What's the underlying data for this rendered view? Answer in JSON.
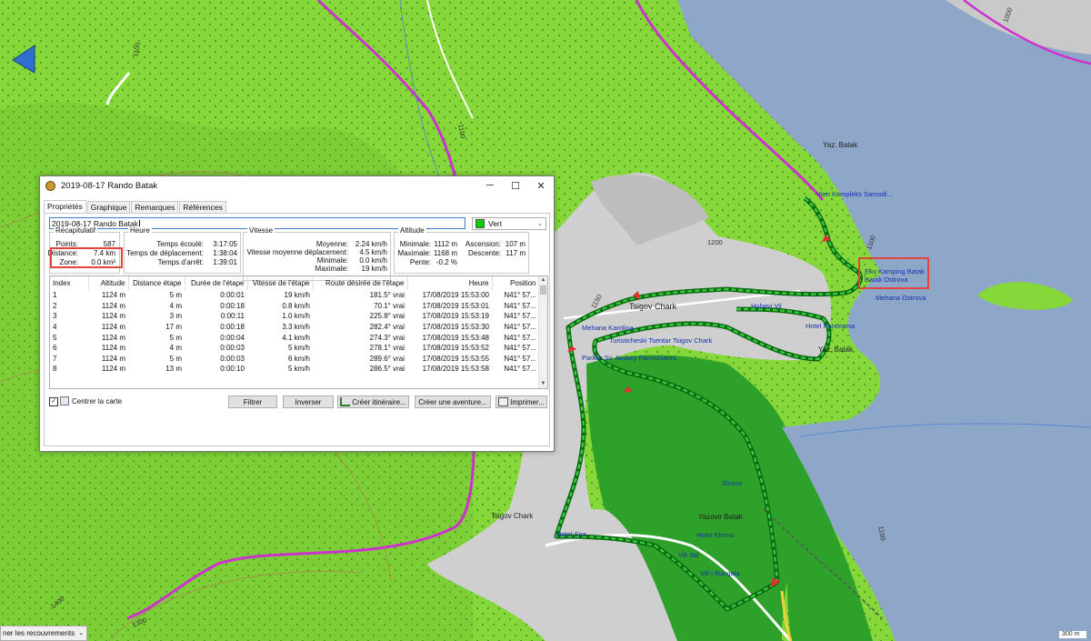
{
  "window": {
    "title": "2019-08-17 Rando Batak",
    "tabs": [
      "Propriétés",
      "Graphique",
      "Remarques",
      "Références"
    ],
    "name_value": "2019-08-17 Rando Batak",
    "color": {
      "label": "Vert",
      "swatch": "#00d000"
    }
  },
  "recap": {
    "title": "Récapitulatif",
    "points_label": "Points:",
    "points_value": "587",
    "distance_label": "Distance:",
    "distance_value": "7.4 km",
    "zone_label": "Zone:",
    "zone_value": "0.0 km²"
  },
  "heure": {
    "title": "Heure",
    "rows": [
      {
        "label": "Temps écoulé:",
        "value": "3:17:05"
      },
      {
        "label": "Temps de déplacement:",
        "value": "1:38:04"
      },
      {
        "label": "Temps d'arrêt:",
        "value": "1:39:01"
      }
    ]
  },
  "vitesse": {
    "title": "Vitesse",
    "rows": [
      {
        "label": "Moyenne:",
        "value": "2.24 km/h"
      },
      {
        "label": "Vitesse moyenne déplacement:",
        "value": "4.5 km/h"
      },
      {
        "label": "Minimale:",
        "value": "0.0 km/h"
      },
      {
        "label": "Maximale:",
        "value": "19 km/h"
      }
    ]
  },
  "altitude": {
    "title": "Altitude",
    "rows": [
      {
        "label": "Minimale:",
        "value": "1112 m"
      },
      {
        "label": "Maximale:",
        "value": "1168 m"
      },
      {
        "label": "Pente:",
        "value": "-0.2 %"
      }
    ],
    "rows2": [
      {
        "label": "Ascension:",
        "value": "107 m"
      },
      {
        "label": "Descente:",
        "value": "117 m"
      }
    ]
  },
  "table": {
    "columns": [
      "Index",
      "Altitude",
      "Distance étape",
      "Durée de l'étape",
      "Vitesse de l'étape",
      "Route désirée de l'étape",
      "Heure",
      "Position"
    ],
    "rows": [
      [
        "1",
        "1124 m",
        "5 m",
        "0:00:01",
        "19 km/h",
        "181.5° vrai",
        "17/08/2019 15:53:00",
        "N41° 57..."
      ],
      [
        "2",
        "1124 m",
        "4 m",
        "0:00:18",
        "0.8 km/h",
        "70.1° vrai",
        "17/08/2019 15:53:01",
        "N41° 57..."
      ],
      [
        "3",
        "1124 m",
        "3 m",
        "0:00:11",
        "1.0 km/h",
        "225.8° vrai",
        "17/08/2019 15:53:19",
        "N41° 57..."
      ],
      [
        "4",
        "1124 m",
        "17 m",
        "0:00:18",
        "3.3 km/h",
        "282.4° vrai",
        "17/08/2019 15:53:30",
        "N41° 57..."
      ],
      [
        "5",
        "1124 m",
        "5 m",
        "0:00:04",
        "4.1 km/h",
        "274.3° vrai",
        "17/08/2019 15:53:48",
        "N41° 57..."
      ],
      [
        "6",
        "1124 m",
        "4 m",
        "0:00:03",
        "5 km/h",
        "278.1° vrai",
        "17/08/2019 15:53:52",
        "N41° 57..."
      ],
      [
        "7",
        "1124 m",
        "5 m",
        "0:00:03",
        "6 km/h",
        "289.6° vrai",
        "17/08/2019 15:53:55",
        "N41° 57..."
      ],
      [
        "8",
        "1124 m",
        "13 m",
        "0:00:10",
        "5 km/h",
        "286.5° vrai",
        "17/08/2019 15:53:58",
        "N41° 57..."
      ]
    ]
  },
  "bottom": {
    "center_map": "Centrer la carte",
    "filter": "Filtrer",
    "invert": "Inverser",
    "create_route": "Créer itinéraire...",
    "create_adventure": "Créer une aventure...",
    "print": "Imprimer..."
  },
  "map": {
    "labels": {
      "tsigov1": "Tsigov Chark",
      "tsigov2": "Tsigov Chark",
      "yaz1": "Yaz. Batak",
      "yaz2": "Yaz. Batak",
      "yazovir": "Yazovir Batak"
    },
    "pois": {
      "samodiva": "Vien Kompleks Samodi...",
      "eko": "Eko Kamping Batak",
      "ostrova": "Batak Ostrova",
      "mehana_ostrova": "Mehana Ostrova",
      "hubavi": "Hubavi Vil",
      "panorama": "Hotel Panorama",
      "karolina": "Mehana Karolina",
      "turist": "Turisticheski Tsentar Tsigov Chark",
      "sv_andrey": "Parklis Sv. Andrey Parvozvanni",
      "slozos": "Slozos",
      "hotel_spa": "Hotel Spa",
      "eterno": "Hotel Eterno",
      "vili": "Vili Stil",
      "bungala": "Vili I Bungala"
    },
    "contours": {
      "c1100a": "1100",
      "c1100b": "1100",
      "c1100c": "1100",
      "c1200": "1200",
      "c1150": "1150",
      "c1300": "1300",
      "c1400": "1400",
      "c1000": "1000",
      "c1100d": "1100"
    },
    "scale": "300 m",
    "bottom_toolbar": "ner les recouvrements"
  }
}
